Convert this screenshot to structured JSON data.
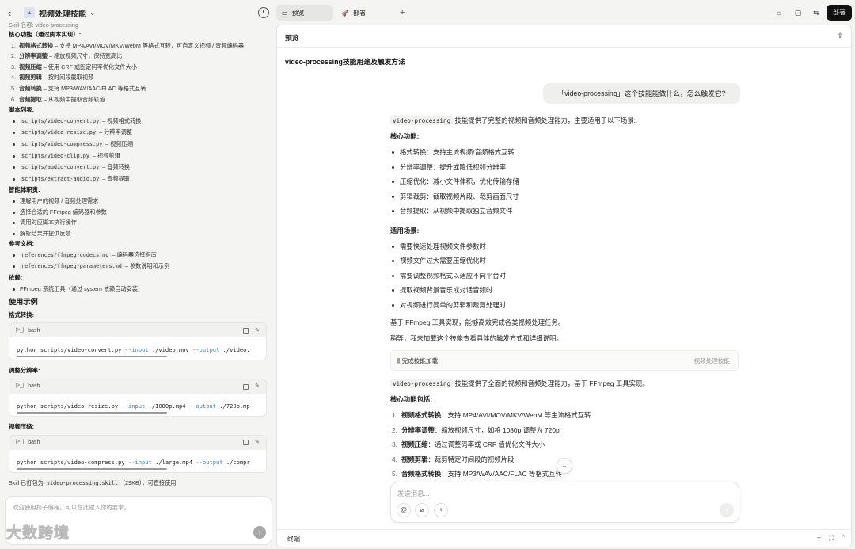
{
  "left": {
    "header_title": "视频处理技能",
    "cut_line": "Skill 名称: video-processing",
    "core_heading": "核心功能（通过脚本实现）:",
    "core_items": [
      {
        "n": "1.",
        "bold": "视频格式转换",
        "rest": " – 支持 MP4/AVI/MOV/MKV/WebM 等格式互转，可自定义视频 / 音频编码器"
      },
      {
        "n": "2.",
        "bold": "分辨率调整",
        "rest": " – 缩放视频尺寸，保持宽高比"
      },
      {
        "n": "3.",
        "bold": "视频压缩",
        "rest": " – 使用 CRF 或固定码率优化文件大小"
      },
      {
        "n": "4.",
        "bold": "视频剪辑",
        "rest": " – 按时间段截取视频"
      },
      {
        "n": "5.",
        "bold": "音频转换",
        "rest": " – 支持 MP3/WAV/AAC/FLAC 等格式互转"
      },
      {
        "n": "6.",
        "bold": "音频提取",
        "rest": " – 从视频中提取音频轨道"
      }
    ],
    "scripts_heading": "脚本列表:",
    "scripts": [
      {
        "code": "scripts/video-convert.py",
        "desc": " – 视频格式转换"
      },
      {
        "code": "scripts/video-resize.py",
        "desc": " – 分辨率调整"
      },
      {
        "code": "scripts/video-compress.py",
        "desc": " – 视频压缩"
      },
      {
        "code": "scripts/video-clip.py",
        "desc": " – 视频剪辑"
      },
      {
        "code": "scripts/audio-convert.py",
        "desc": " – 音频转换"
      },
      {
        "code": "scripts/extract-audio.py",
        "desc": " – 音频提取"
      }
    ],
    "agent_heading": "智能体职责:",
    "agent_items": [
      "理解用户的视频 / 音频处理需求",
      "选择合适的 FFmpeg 编码器和参数",
      "调用对应脚本执行操作",
      "解析结果并提供反馈"
    ],
    "refs_heading": "参考文档:",
    "refs": [
      {
        "code": "references/ffmpeg-codecs.md",
        "desc": " – 编码器选择指南"
      },
      {
        "code": "references/ffmpeg-parameters.md",
        "desc": " – 参数说明和示例"
      }
    ],
    "deps_heading": "依赖:",
    "deps": [
      "FFmpeg 系统工具（通过 system 依赖自动安装）"
    ],
    "usage_heading": "使用示例",
    "examples": [
      {
        "label": "格式转换:",
        "lang": "bash",
        "cmd": "python scripts/video-convert.py ",
        "f1": "--input",
        "a1": " ./video.mov ",
        "f2": "--output",
        "a2": " ./video."
      },
      {
        "label": "调整分辨率:",
        "lang": "bash",
        "cmd": "python scripts/video-resize.py ",
        "f1": "--input",
        "a1": " ./1080p.mp4 ",
        "f2": "--output",
        "a2": " ./720p.mp"
      },
      {
        "label": "视频压缩:",
        "lang": "bash",
        "cmd": "python scripts/video-compress.py ",
        "f1": "--input",
        "a1": " ./large.mp4 ",
        "f2": "--output",
        "a2": " ./compr"
      }
    ],
    "packaged_pre": "Skill 已打包为 ",
    "packaged_code": "video-processing.skill",
    "packaged_post": "（29KB），可直接使用!",
    "input_placeholder": "欢迎使用扣子编程。可以在此输入你的要求。",
    "watermark": "大数跨境"
  },
  "topbar": {
    "tab_preview": "预览",
    "tab_deploy": "部署",
    "deploy_button": "部署"
  },
  "panel": {
    "header": "预览",
    "doc_title": "video-processing技能用途及触发方法",
    "user_message": "「video-processing」这个技能能做什么，怎么触发它?",
    "answer1_code": "video-processing",
    "answer1_text": " 技能提供了完整的视频和音频处理能力，主要适用于以下场景:",
    "core_heading": "核心功能:",
    "core_items": [
      "格式转换：支持主流视频/音频格式互转",
      "分辨率调整：提升或降低视频分辨率",
      "压缩优化：减小文件体积，优化传输存储",
      "剪辑裁剪：截取视频片段、裁剪画面尺寸",
      "音频提取：从视频中提取独立音频文件"
    ],
    "scenes_heading": "适用场景:",
    "scene_items": [
      "需要快速处理视频文件参数时",
      "视频文件过大需要压缩优化时",
      "需要调整视频格式以适应不同平台时",
      "提取视频背景音乐或对话音频时",
      "对视频进行简单的剪辑和裁剪处理时"
    ],
    "p_ffmpeg": "基于 FFmpeg 工具实现，能够高效完成各类视频处理任务。",
    "p_wait": "稍等，我来加载这个技能查看具体的触发方式和详细说明。",
    "skill_card_left": "完成技能加载",
    "skill_card_right": "视频处理技能",
    "answer2_code": "video-processing",
    "answer2_text": " 技能提供了全面的视频和音频处理能力，基于 FFmpeg 工具实现。",
    "core2_heading": "核心功能包括:",
    "core2_items": [
      {
        "n": "1.",
        "bold": "视频格式转换",
        "rest": "：支持 MP4/AVI/MOV/MKV/WebM 等主流格式互转"
      },
      {
        "n": "2.",
        "bold": "分辨率调整",
        "rest": "：缩放视频尺寸，如将 1080p 调整为 720p"
      },
      {
        "n": "3.",
        "bold": "视频压缩",
        "rest": "：通过调整码率或 CRF 值优化文件大小"
      },
      {
        "n": "4.",
        "bold": "视频剪辑",
        "rest": "：裁剪特定时间段的视频片段"
      },
      {
        "n": "5.",
        "bold": "音频格式转换",
        "rest": "：支持 MP3/WAV/AAC/FLAC 等格式互转"
      }
    ],
    "composer_placeholder": "发送消息...",
    "terminal_label": "终端"
  }
}
